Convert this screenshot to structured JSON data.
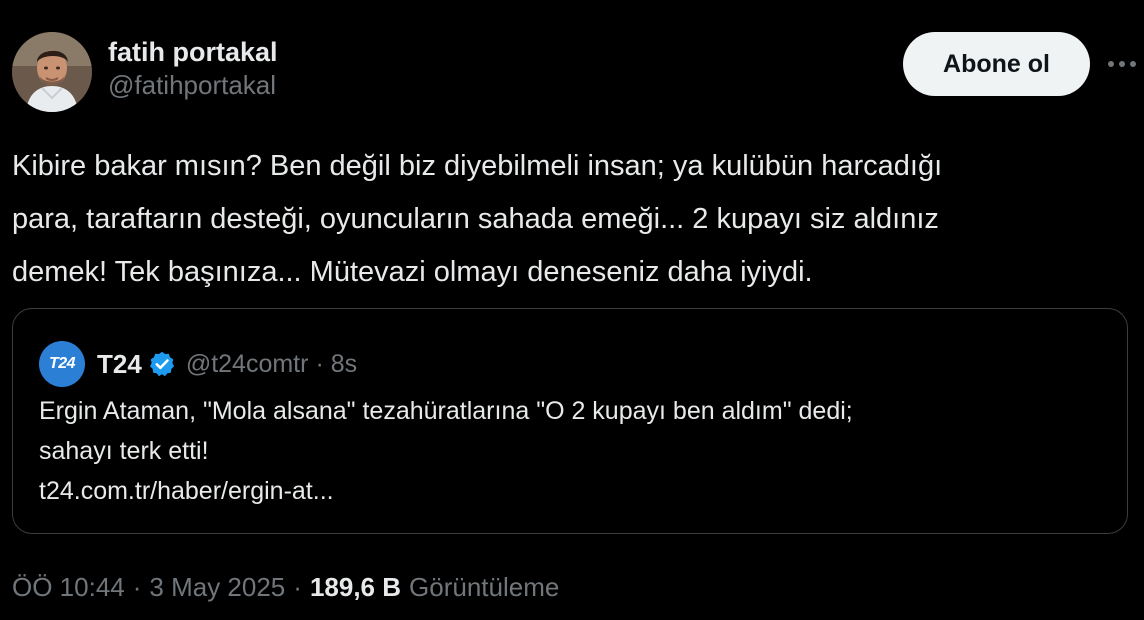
{
  "author": {
    "display_name": "fatih portakal",
    "handle": "@fatihportakal"
  },
  "follow_button": "Abone ol",
  "more_icon": "more-dots-icon",
  "tweet": {
    "text": "Kibire bakar mısın? Ben değil biz diyebilmeli insan; ya kulübün harcadığı\npara, taraftarın desteği, oyuncuların sahada emeği... 2 kupayı siz aldınız\ndemek! Tek başınıza... Mütevazi olmayı deneseniz daha iyiydi."
  },
  "quoted_tweet": {
    "avatar_text": "T24",
    "name": "T24",
    "verified_icon": "verified-badge-icon",
    "handle": "@t24comtr",
    "separator": "·",
    "time": "8s",
    "text": "Ergin Ataman, \"Mola alsana\" tezahüratlarına \"O 2 kupayı ben aldım\" dedi;\nsahayı terk etti!\nt24.com.tr/haber/ergin-at..."
  },
  "meta": {
    "time": "ÖÖ 10:44",
    "separator": "·",
    "date": "3 May 2025",
    "views_count": "189,6 B",
    "views_label": "Görüntüleme"
  },
  "colors": {
    "background": "#000000",
    "text_primary": "#e7e9ea",
    "text_secondary": "#71767b",
    "border": "#3a3d41",
    "button_bg": "#eff3f4",
    "verified": "#1d9bf0",
    "t24_brand": "#2b7fd4"
  }
}
